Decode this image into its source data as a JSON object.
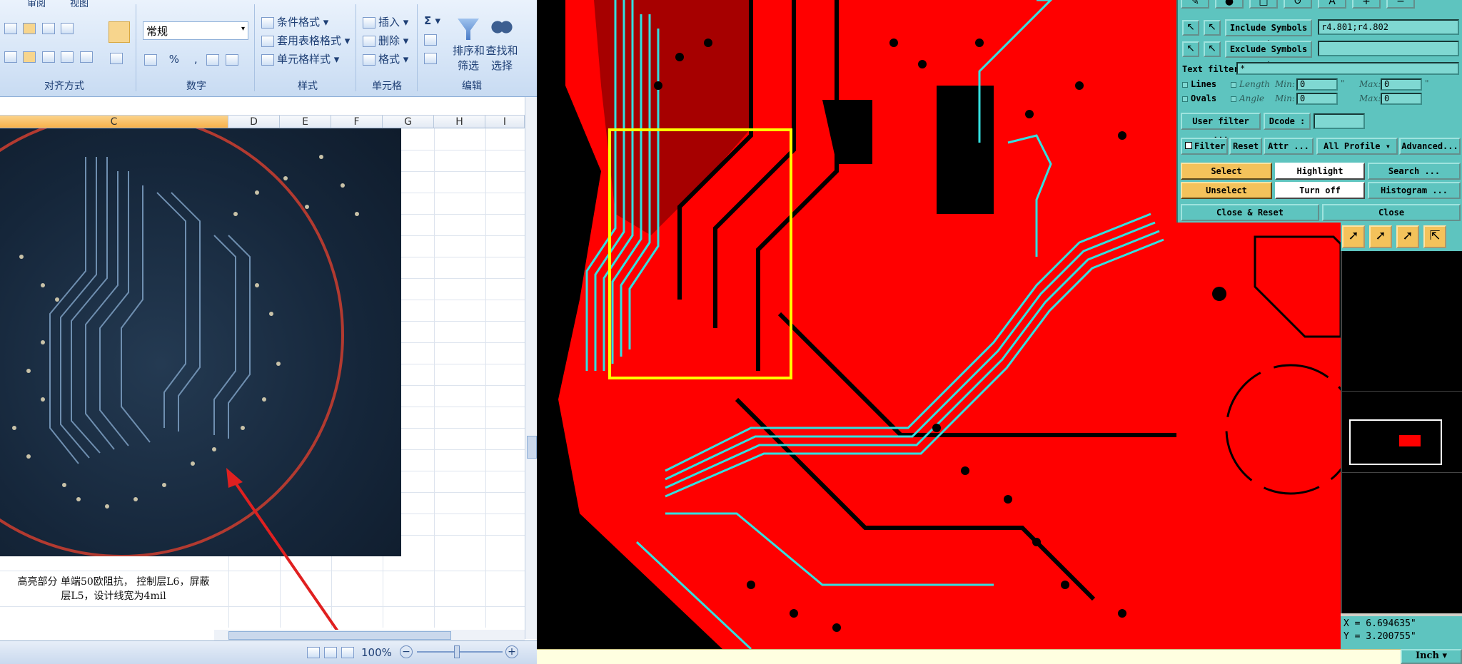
{
  "excel": {
    "menu_tabs": [
      "审阅",
      "视图"
    ],
    "ribbon": {
      "alignment_group": "对齐方式",
      "number_group": "数字",
      "number_format": "常规",
      "percent_symbol": "%",
      "comma_symbol": ",",
      "styles_group": "样式",
      "conditional_format": "条件格式",
      "table_format": "套用表格格式",
      "cell_styles": "单元格样式",
      "cells_group": "单元格",
      "insert": "插入",
      "delete": "删除",
      "format": "格式",
      "editing_group": "编辑",
      "sum_symbol": "Σ",
      "sort_filter_line1": "排序和",
      "sort_filter_line2": "筛选",
      "find_select_line1": "查找和",
      "find_select_line2": "选择"
    },
    "columns": [
      "C",
      "D",
      "E",
      "F",
      "G",
      "H",
      "I"
    ],
    "note_line1": "高亮部分  单端50欧阻抗， 控制层L6，屏蔽",
    "note_line2": "层L5，设计线宽为4mil",
    "zoom": "100%",
    "colors": {
      "selected_column": "#f7b14b",
      "annotation": "#e02020"
    }
  },
  "cam_panel": {
    "include_symbols_label": "Include Symbols :",
    "include_symbols_value": "r4.801;r4.802",
    "exclude_symbols_label": "Exclude Symbols :",
    "exclude_symbols_value": "",
    "text_filter_label": "Text filter",
    "text_filter_value": "*",
    "lines_label": "Lines",
    "ovals_label": "Ovals",
    "length_label": "Length",
    "angle_label": "Angle",
    "min_label": "Min:",
    "max_label": "Max:",
    "length_min": "0",
    "length_max": "0",
    "angle_min": "0",
    "angle_max": "0",
    "length_unit": "\"",
    "angle_unit": "°",
    "user_filter": "User filter ...",
    "dcode_label": "Dcode :",
    "dcode_value": "",
    "filter": "Filter",
    "reset": "Reset",
    "attr": "Attr ...",
    "all_profile": "All Profile",
    "advanced": "Advanced...",
    "select": "Select",
    "highlight": "Highlight",
    "search": "Search ...",
    "unselect": "Unselect",
    "turn_off": "Turn off",
    "histogram": "Histogram ...",
    "close_reset": "Close & Reset",
    "close": "Close",
    "coord_x": "X = 6.694635\"",
    "coord_y": "Y = 3.200755\"",
    "units": "Inch",
    "colors": {
      "panel": "#5ec4bf",
      "copper": "#ff0000",
      "trace_highlight": "#33e0e0",
      "selection_box": "#ffff00"
    }
  }
}
